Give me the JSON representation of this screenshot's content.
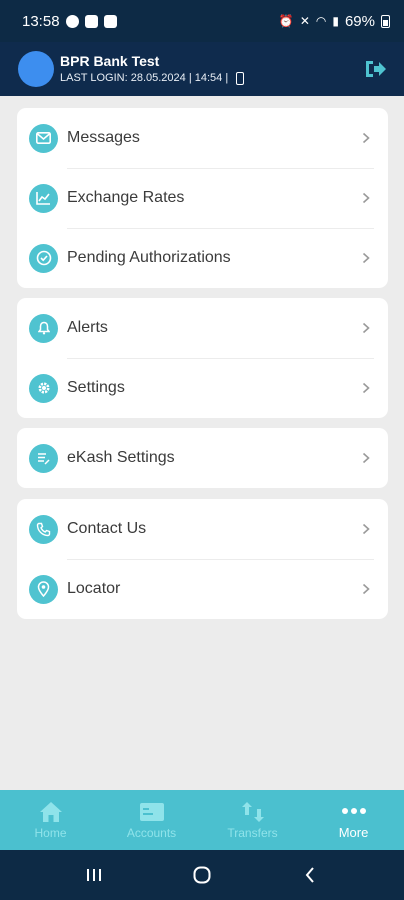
{
  "status_bar": {
    "time": "13:58",
    "battery_percent": "69%",
    "icons": [
      "whatsapp-icon",
      "gallery-icon",
      "check-icon",
      "alarm-icon",
      "mute-icon",
      "wifi-icon",
      "signal-icon",
      "battery-icon"
    ]
  },
  "header": {
    "user_name": "BPR Bank Test",
    "last_login": "LAST LOGIN: 28.05.2024 | 14:54 |",
    "bg_color": "#0f2b4d"
  },
  "menu": {
    "group1": [
      {
        "label": "Messages",
        "icon": "mail-icon"
      },
      {
        "label": "Exchange Rates",
        "icon": "chart-icon"
      },
      {
        "label": "Pending Authorizations",
        "icon": "check-circle-icon"
      }
    ],
    "group2": [
      {
        "label": "Alerts",
        "icon": "bell-icon"
      },
      {
        "label": "Settings",
        "icon": "gear-icon"
      }
    ],
    "group3": [
      {
        "label": "eKash Settings",
        "icon": "ekash-icon"
      }
    ],
    "group4": [
      {
        "label": "Contact Us",
        "icon": "phone-icon"
      },
      {
        "label": "Locator",
        "icon": "location-pin-icon"
      }
    ],
    "accent_color": "#4fc3d0"
  },
  "bottom_nav": {
    "items": [
      {
        "label": "Home",
        "icon": "home-icon",
        "active": false
      },
      {
        "label": "Accounts",
        "icon": "card-icon",
        "active": false
      },
      {
        "label": "Transfers",
        "icon": "transfer-icon",
        "active": false
      },
      {
        "label": "More",
        "icon": "more-dots-icon",
        "active": true
      }
    ],
    "bg_color": "#4bc0cf"
  }
}
